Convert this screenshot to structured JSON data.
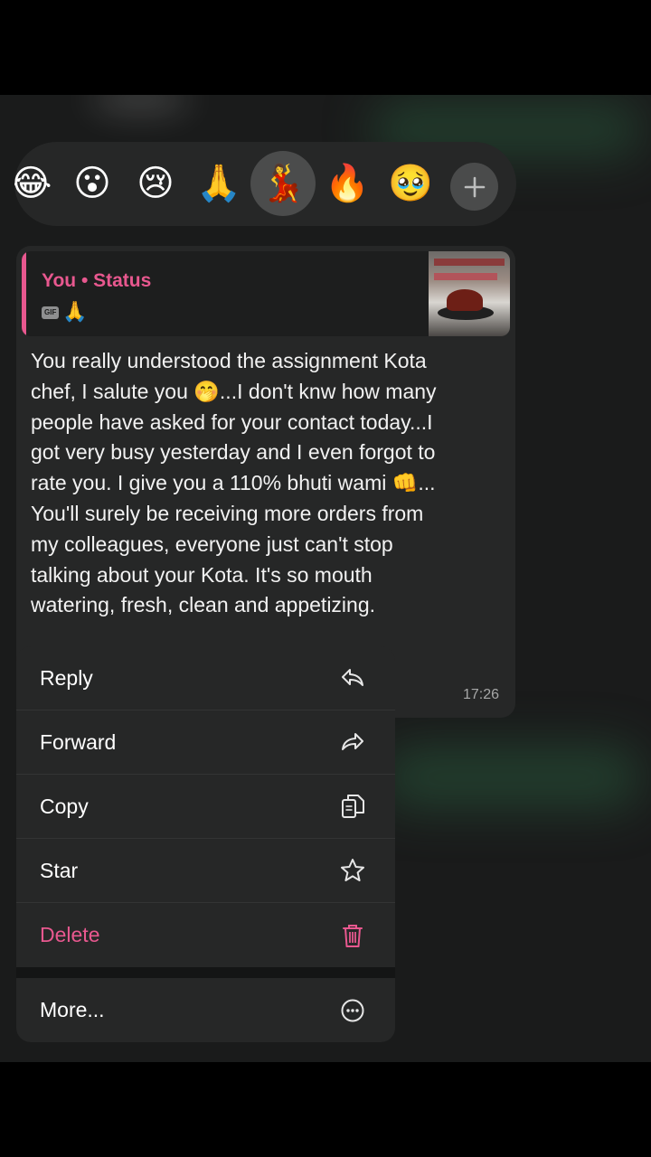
{
  "reactions": {
    "items": [
      {
        "name": "laughing-tears",
        "glyph": "😂"
      },
      {
        "name": "surprised",
        "glyph": "😮"
      },
      {
        "name": "crying",
        "glyph": "😢"
      },
      {
        "name": "folded-hands",
        "glyph": "🙏"
      },
      {
        "name": "dancer",
        "glyph": "💃"
      },
      {
        "name": "fire",
        "glyph": "🔥"
      },
      {
        "name": "pleading",
        "glyph": "🥹"
      }
    ],
    "selected": "dancer",
    "add_icon": "plus-icon"
  },
  "message": {
    "quote": {
      "author": "You • Status",
      "gif_badge": "GIF",
      "emoji": "🙏",
      "thumbnail": "food-photo"
    },
    "text": "You really understood the assignment Kota\nchef, I salute you 🤭...I don't knw how many\npeople have asked for your contact today...I\ngot very busy  yesterday and I even forgot to\nrate you. I give you a 110% bhuti wami 👊...\nYou'll surely be receiving more orders from\nmy colleagues, everyone just can't stop\ntalking about  your Kota. It's so mouth\nwatering, fresh, clean and appetizing.",
    "time": "17:26"
  },
  "menu": {
    "items": [
      {
        "label": "Reply",
        "icon": "reply-icon"
      },
      {
        "label": "Forward",
        "icon": "forward-icon"
      },
      {
        "label": "Copy",
        "icon": "copy-icon"
      },
      {
        "label": "Star",
        "icon": "star-icon"
      },
      {
        "label": "Delete",
        "icon": "trash-icon"
      }
    ],
    "more": {
      "label": "More...",
      "icon": "more-icon"
    }
  },
  "colors": {
    "accent": "#e8588f",
    "surface": "#262727",
    "background": "#1a1b1b"
  }
}
